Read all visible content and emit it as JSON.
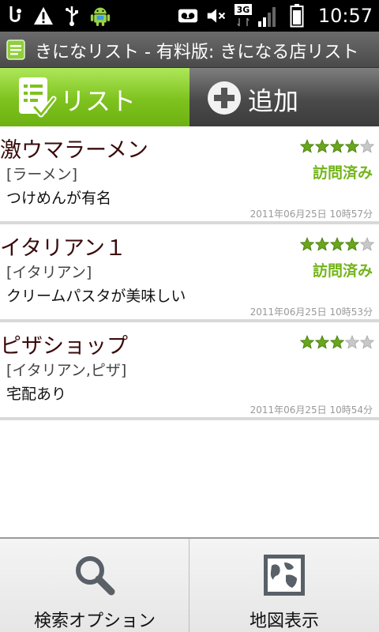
{
  "status_bar": {
    "clock": "10:57",
    "network_label": "3G",
    "icons": [
      "usb-debug-icon",
      "warning-icon",
      "usb-icon",
      "android-icon",
      "voicemail-icon",
      "mute-icon",
      "signal-icon",
      "battery-icon"
    ]
  },
  "title_bar": {
    "title": "きになリスト - 有料版: きになる店リスト",
    "icon": "notepad-icon"
  },
  "tabs": [
    {
      "label": "リスト",
      "icon": "checklist-icon",
      "selected": true
    },
    {
      "label": "追加",
      "icon": "plus-circle-icon",
      "selected": false
    }
  ],
  "list": {
    "items": [
      {
        "name": "激ウマラーメン",
        "category": "[ラーメン]",
        "note": "つけめんが有名",
        "date": "2011年06月25日 10時57分",
        "rating": 4,
        "visited_label": "訪問済み"
      },
      {
        "name": "イタリアン１",
        "category": "[イタリアン]",
        "note": "クリームパスタが美味しい",
        "date": "2011年06月25日 10時53分",
        "rating": 4,
        "visited_label": "訪問済み"
      },
      {
        "name": "ピザショップ",
        "category": "[イタリアン,ピザ]",
        "note": "宅配あり",
        "date": "2011年06月25日 10時54分",
        "rating": 3,
        "visited_label": ""
      }
    ],
    "max_rating": 5
  },
  "menu": {
    "search_label": "検索オプション",
    "map_label": "地図表示"
  },
  "colors": {
    "accent_green": "#7ec21e",
    "visited_green": "#73b51a",
    "star_green": "#6aa51b",
    "star_empty": "#c8c8c8",
    "name_color": "#3a0b0b"
  }
}
